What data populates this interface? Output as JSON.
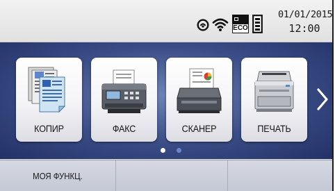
{
  "status_bar": {
    "icons": [
      "connection-icon",
      "wifi-icon",
      "eco-toner-icon",
      "ink-level-icon"
    ],
    "eco_label": "ECO",
    "date": "01/01/2015",
    "time": "12:00"
  },
  "functions": [
    {
      "label": "КОПИР",
      "icon": "copier-icon"
    },
    {
      "label": "ФАКС",
      "icon": "fax-icon"
    },
    {
      "label": "СКАНЕР",
      "icon": "scanner-icon"
    },
    {
      "label": "ПЕЧАТЬ",
      "icon": "printer-icon"
    }
  ],
  "navigation": {
    "next_icon": "chevron-right-icon",
    "page_indicator": {
      "pages": 2,
      "current": 1
    }
  },
  "bottom_bar": {
    "my_function_label": "МОЯ ФУНКЦ.",
    "slot_2_label": "",
    "slot_3_label": ""
  },
  "colors": {
    "panel_dark": "#1b2a5e",
    "panel_light": "#6e83b5",
    "status_bg": "#e9e9e9",
    "bottom_bg": "#cbd0dc"
  }
}
